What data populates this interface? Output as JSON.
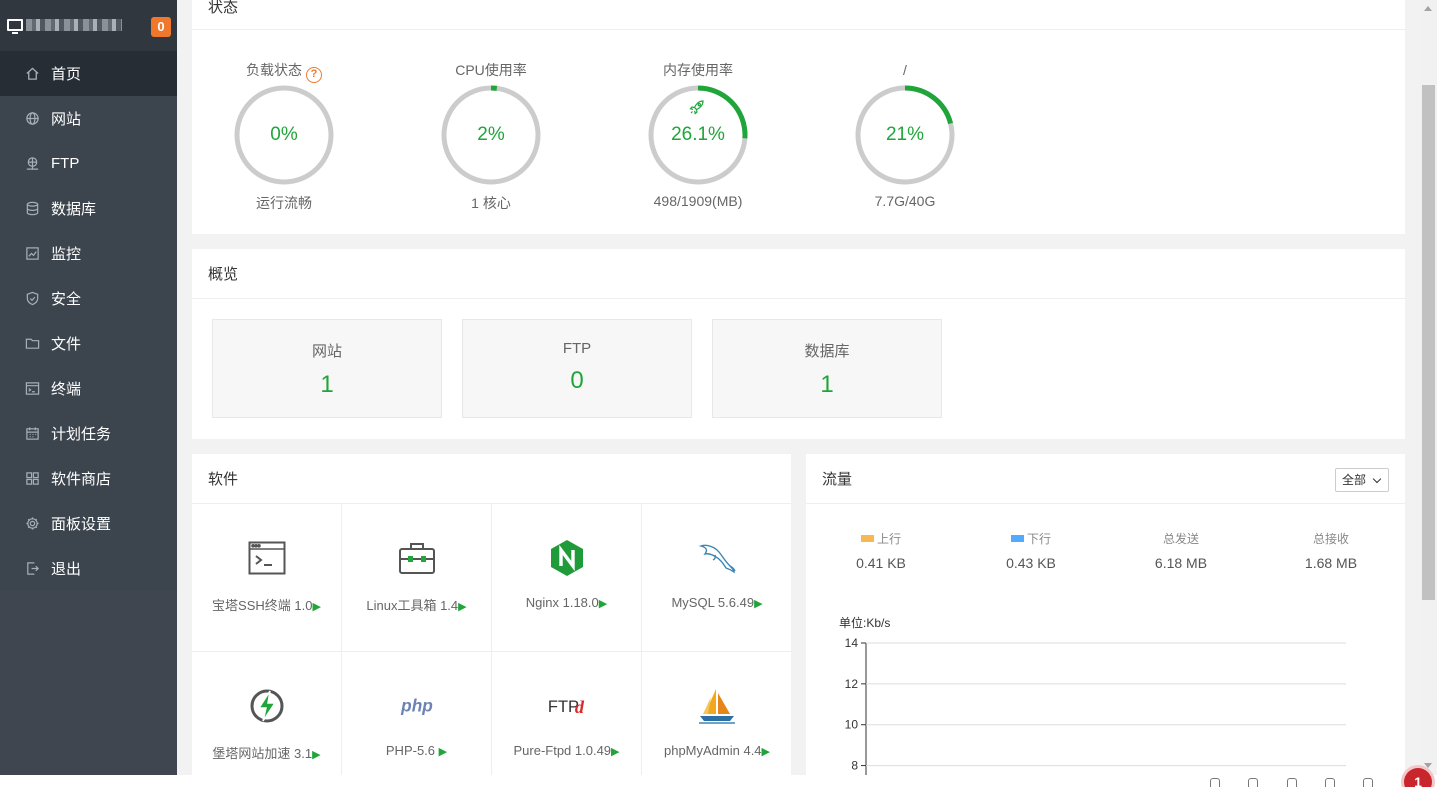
{
  "sidebar": {
    "badge_count": "0",
    "items": [
      {
        "label": "首页",
        "icon": "home-icon",
        "active": true
      },
      {
        "label": "网站",
        "icon": "globe-icon"
      },
      {
        "label": "FTP",
        "icon": "ftp-icon"
      },
      {
        "label": "数据库",
        "icon": "database-icon"
      },
      {
        "label": "监控",
        "icon": "monitor-icon"
      },
      {
        "label": "安全",
        "icon": "shield-icon"
      },
      {
        "label": "文件",
        "icon": "folder-icon"
      },
      {
        "label": "终端",
        "icon": "terminal-icon"
      },
      {
        "label": "计划任务",
        "icon": "calendar-icon"
      },
      {
        "label": "软件商店",
        "icon": "grid-icon"
      },
      {
        "label": "面板设置",
        "icon": "gear-icon"
      },
      {
        "label": "退出",
        "icon": "logout-icon"
      }
    ]
  },
  "status": {
    "title": "状态",
    "gauges": [
      {
        "title": "负载状态",
        "value": "0%",
        "percent": 0,
        "bottom": "运行流畅",
        "help": "?"
      },
      {
        "title": "CPU使用率",
        "value": "2%",
        "percent": 2,
        "bottom": "1 核心"
      },
      {
        "title": "内存使用率",
        "value": "26.1%",
        "percent": 26.1,
        "bottom": "498/1909(MB)"
      },
      {
        "title": "/",
        "value": "21%",
        "percent": 21,
        "bottom": "7.7G/40G"
      }
    ],
    "colors": {
      "ring_bg": "#cccccc",
      "ring_fg": "#20a53a"
    }
  },
  "overview": {
    "title": "概览",
    "boxes": [
      {
        "label": "网站",
        "value": "1"
      },
      {
        "label": "FTP",
        "value": "0"
      },
      {
        "label": "数据库",
        "value": "1"
      }
    ]
  },
  "software": {
    "title": "软件",
    "items": [
      {
        "name": "宝塔SSH终端 1.0",
        "icon": "terminal-window-icon"
      },
      {
        "name": "Linux工具箱 1.4",
        "icon": "toolbox-icon"
      },
      {
        "name": "Nginx 1.18.0",
        "icon": "nginx-icon"
      },
      {
        "name": "MySQL 5.6.49",
        "icon": "mysql-dolphin-icon"
      },
      {
        "name": "堡塔网站加速 3.1",
        "icon": "lightning-icon"
      },
      {
        "name": "PHP-5.6 ",
        "icon": "php-icon"
      },
      {
        "name": "Pure-Ftpd 1.0.49",
        "icon": "ftpd-icon"
      },
      {
        "name": "phpMyAdmin 4.4",
        "icon": "sailboat-icon"
      }
    ],
    "play_glyph": "▶",
    "php_logo_text": "php",
    "ftpd_logo_text": "FTP",
    "ftpd_logo_d": "d"
  },
  "traffic": {
    "title": "流量",
    "filter": "全部",
    "stats": [
      {
        "label": "上行",
        "value": "0.41 KB",
        "swatch": "#f7b851"
      },
      {
        "label": "下行",
        "value": "0.43 KB",
        "swatch": "#52a9ff"
      },
      {
        "label": "总发送",
        "value": "6.18 MB"
      },
      {
        "label": "总接收",
        "value": "1.68 MB"
      }
    ],
    "unit": "单位:Kb/s"
  },
  "chart_data": {
    "type": "line",
    "ylabel": "单位:Kb/s",
    "yticks": [
      8,
      10,
      12,
      14
    ],
    "ylim": [
      7,
      14
    ],
    "series": [],
    "grid": true
  },
  "notifications": {
    "count": "1"
  }
}
